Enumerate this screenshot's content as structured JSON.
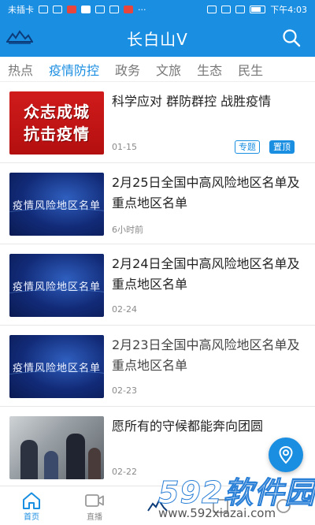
{
  "status_bar": {
    "carrier": "未插卡",
    "time": "下午4:03"
  },
  "header": {
    "title": "长白山V"
  },
  "tabs": [
    "热点",
    "疫情防控",
    "政务",
    "文旅",
    "生态",
    "民生"
  ],
  "active_tab": "疫情防控",
  "articles": [
    {
      "title": "科学应对 群防群控 战胜疫情",
      "date": "01-15",
      "thumb_text_1": "众志成城",
      "thumb_text_2": "抗击疫情",
      "badge_topic": "专题",
      "badge_top": "置顶"
    },
    {
      "title": "2月25日全国中高风险地区名单及重点地区名单",
      "date": "6小时前",
      "thumb_text": "疫情风险地区名单"
    },
    {
      "title": "2月24日全国中高风险地区名单及重点地区名单",
      "date": "02-24",
      "thumb_text": "疫情风险地区名单"
    },
    {
      "title": "2月23日全国中高风险地区名单及重点地区名单",
      "date": "02-23",
      "thumb_text": "疫情风险地区名单"
    },
    {
      "title": "愿所有的守候都能奔向团圆",
      "date": "02-22"
    }
  ],
  "bottom_nav": {
    "home": "首页",
    "live": "直播"
  },
  "watermark": {
    "brand": "592软件园",
    "url": "www.592xiazai.com"
  },
  "colors": {
    "accent": "#1a8ee1",
    "thumb_red": "#c8161a",
    "thumb_blue": "#163a8a"
  }
}
